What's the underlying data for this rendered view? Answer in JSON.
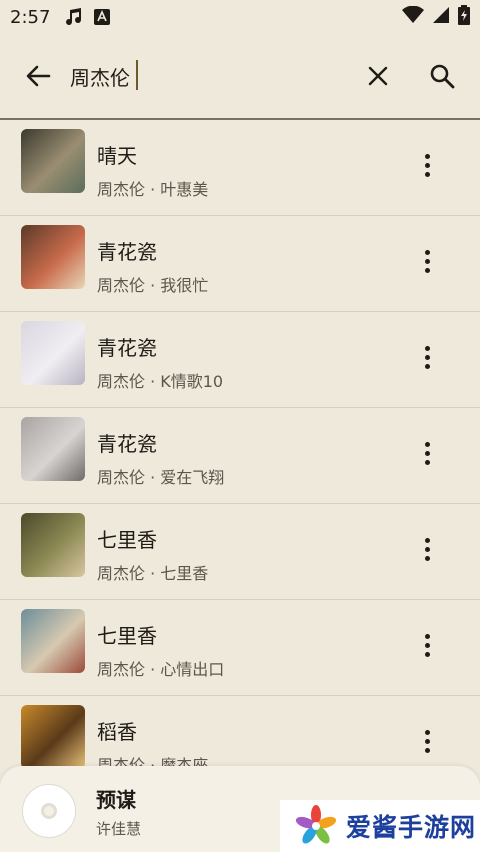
{
  "status_bar": {
    "time": "2:57"
  },
  "search": {
    "query": "周杰伦"
  },
  "results": [
    {
      "title": "晴天",
      "subtitle": "周杰伦 · 叶惠美",
      "cover_colors": [
        "#3b3a2e",
        "#9a8d72",
        "#5a6e5a"
      ]
    },
    {
      "title": "青花瓷",
      "subtitle": "周杰伦 · 我很忙",
      "cover_colors": [
        "#5b3a2a",
        "#c76a4a",
        "#e8d6b8"
      ]
    },
    {
      "title": "青花瓷",
      "subtitle": "周杰伦 · K情歌10",
      "cover_colors": [
        "#d9d6e0",
        "#f0eef2",
        "#b7b3c2"
      ]
    },
    {
      "title": "青花瓷",
      "subtitle": "周杰伦 · 爱在飞翔",
      "cover_colors": [
        "#a9a4a2",
        "#d8d4d2",
        "#6e6a68"
      ]
    },
    {
      "title": "七里香",
      "subtitle": "周杰伦 · 七里香",
      "cover_colors": [
        "#4b4a2a",
        "#8d8a55",
        "#d8c6a0"
      ]
    },
    {
      "title": "七里香",
      "subtitle": "周杰伦 · 心情出口",
      "cover_colors": [
        "#6d8e9a",
        "#d6c9b0",
        "#9b4a3a"
      ]
    },
    {
      "title": "稻香",
      "subtitle": "周杰伦 · 魔杰座",
      "cover_colors": [
        "#c88a2a",
        "#5a3a1a",
        "#e8c27a"
      ]
    }
  ],
  "mini_player": {
    "title": "预谋",
    "artist": "许佳慧"
  },
  "watermark": {
    "text": "爱酱手游网"
  },
  "colors": {
    "background": "#efe9dc",
    "text": "#1f1b16",
    "secondary_text": "#5c564c",
    "watermark_blue": "#1d3f9e"
  }
}
